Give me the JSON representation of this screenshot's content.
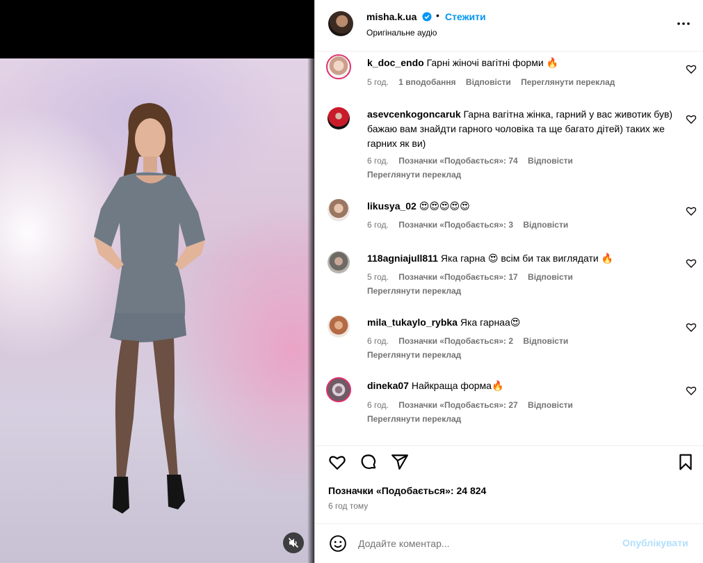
{
  "post": {
    "username": "misha.k.ua",
    "dot": "•",
    "follow_label": "Стежити",
    "audio": "Оригінальне аудіо"
  },
  "comments": [
    {
      "username": "k_doc_endo",
      "text": "Гарні жіночі вагітні форми 🔥",
      "time": "5 год.",
      "likes": "1 вподобання",
      "reply": "Відповісти",
      "translate": "Переглянути переклад"
    },
    {
      "username": "asevcenkogoncaruk",
      "text": "Гарна вагітна жінка, гарний у вас животик був) бажаю вам знайдти гарного чоловіка та ще багато дітей) таких же гарних як ви)",
      "time": "6 год.",
      "likes": "Позначки «Подобається»: 74",
      "reply": "Відповісти",
      "translate": "Переглянути переклад"
    },
    {
      "username": "likusya_02",
      "text": "😍😍😍😍😍",
      "time": "6 год.",
      "likes": "Позначки «Подобається»: 3",
      "reply": "Відповісти"
    },
    {
      "username": "118agniajull811",
      "text": "Яка гарна 😍 всім би так виглядати 🔥",
      "time": "5 год.",
      "likes": "Позначки «Подобається»: 17",
      "reply": "Відповісти",
      "translate": "Переглянути переклад"
    },
    {
      "username": "mila_tukaylo_rybka",
      "text": "Яка гарнаа😍",
      "time": "6 год.",
      "likes": "Позначки «Подобається»: 2",
      "reply": "Відповісти",
      "translate": "Переглянути переклад"
    },
    {
      "username": "dineka07",
      "text": "Найкраща форма🔥",
      "time": "6 год.",
      "likes": "Позначки «Подобається»: 27",
      "reply": "Відповісти",
      "translate": "Переглянути переклад"
    }
  ],
  "footer": {
    "likes": "Позначки «Подобається»: 24 824",
    "time": "6 год тому",
    "comment_placeholder": "Додайте коментар...",
    "post_label": "Опублікувати"
  },
  "colors": {
    "accent": "#0095f6",
    "muted": "#737373",
    "post_disabled": "#b2dffc",
    "verified": "#0095f6"
  },
  "icons": {
    "header": [
      "verified-badge-icon",
      "more-options-icon"
    ],
    "actions": [
      "heart-icon",
      "comment-icon",
      "share-icon",
      "bookmark-icon"
    ],
    "media": [
      "muted-speaker-icon"
    ],
    "compose": [
      "emoji-icon"
    ]
  }
}
